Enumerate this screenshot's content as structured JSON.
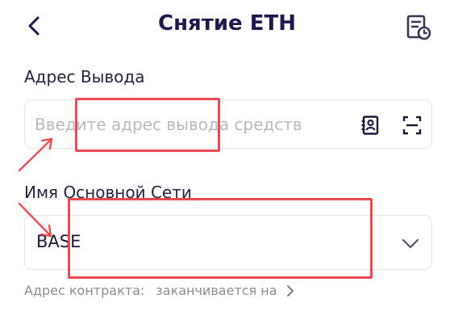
{
  "header": {
    "title": "Снятие ETH",
    "back_icon": "chevron-left-icon",
    "history_icon": "document-clock-icon"
  },
  "address_section": {
    "label": "Адрес Вывода",
    "placeholder": "Введите адрес вывода средств",
    "value": "",
    "contacts_icon": "address-book-icon",
    "scan_icon": "scan-icon"
  },
  "network_section": {
    "label": "Имя Основной Сети",
    "selected_value": "BASE",
    "chevron_icon": "chevron-down-icon"
  },
  "contract": {
    "label": "Адрес контракта:",
    "suffix": "заканчивается на",
    "chevron_icon": "chevron-right-icon"
  },
  "colors": {
    "title": "#1f1a4d",
    "annotation": "#ea4b52",
    "placeholder": "#b8b7c2",
    "border": "#e3e3e8"
  }
}
